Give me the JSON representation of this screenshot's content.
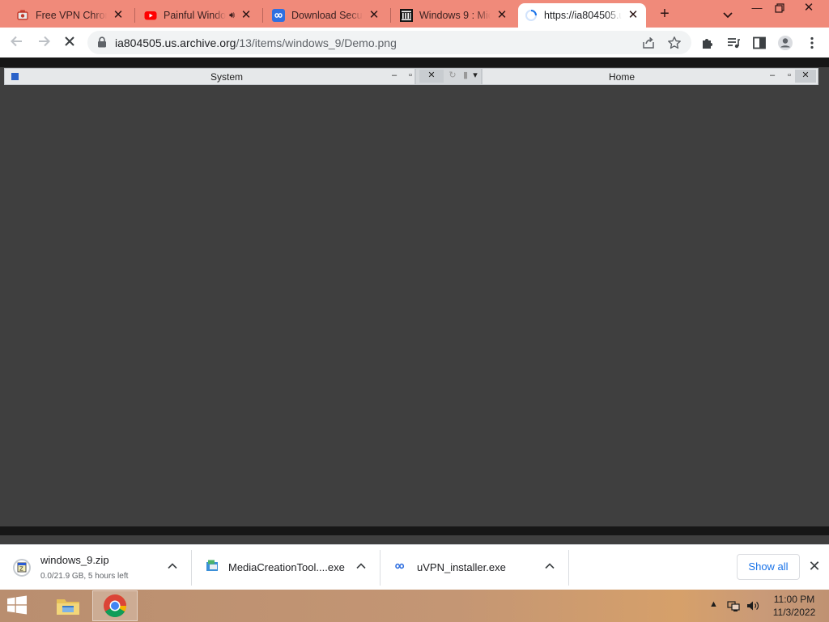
{
  "browser": {
    "tabs": [
      {
        "title": "Free VPN Chrome",
        "icon": "vpn-favicon"
      },
      {
        "title": "Painful Windows",
        "icon": "youtube-favicon",
        "audio": true
      },
      {
        "title": "Download Secure",
        "icon": "infinity-favicon"
      },
      {
        "title": "Windows 9 : Micr",
        "icon": "archive-favicon"
      },
      {
        "title": "https://ia804505.us",
        "icon": "loading-spinner",
        "active": true
      }
    ],
    "new_tab_label": "+",
    "address_bar": {
      "host": "ia804505.us.archive.org",
      "path": "/13/items/windows_9/Demo.png"
    }
  },
  "page": {
    "left_window_title": "System",
    "right_window_title": "Home"
  },
  "downloads": {
    "items": [
      {
        "name": "windows_9.zip",
        "status": "0.0/21.9 GB, 5 hours left",
        "icon": "zip-icon"
      },
      {
        "name": "MediaCreationTool....exe",
        "status": "",
        "icon": "installer-icon"
      },
      {
        "name": "uVPN_installer.exe",
        "status": "",
        "icon": "infinity-icon"
      }
    ],
    "show_all_label": "Show all"
  },
  "taskbar": {
    "time": "11:00 PM",
    "date": "11/3/2022"
  },
  "colors": {
    "tab_strip": "#f08a7a",
    "page_background": "#3f3f3f",
    "link_blue": "#1a73e8"
  }
}
